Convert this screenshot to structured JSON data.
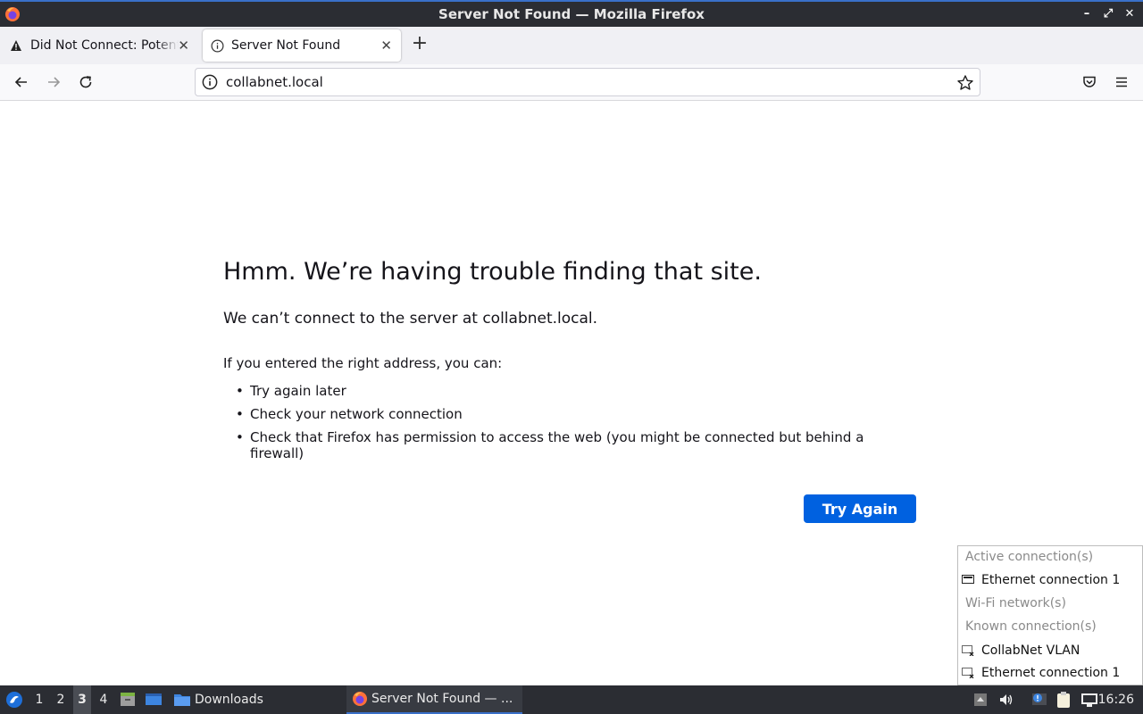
{
  "window": {
    "title": "Server Not Found — Mozilla Firefox"
  },
  "tabs": [
    {
      "title": "Did Not Connect: Potential Security Issue",
      "icon": "warning-icon",
      "active": false
    },
    {
      "title": "Server Not Found",
      "icon": "info-icon",
      "active": true
    }
  ],
  "navbar": {
    "url": "collabnet.local"
  },
  "error_page": {
    "title": "Hmm. We’re having trouble finding that site.",
    "description": "We can’t connect to the server at collabnet.local.",
    "hint": "If you entered the right address, you can:",
    "suggestions": [
      "Try again later",
      "Check your network connection",
      "Check that Firefox has permission to access the web (you might be connected but behind a firewall)"
    ],
    "try_again_label": "Try Again"
  },
  "network_menu": {
    "active_header": "Active connection(s)",
    "active_connections": [
      "Ethernet connection 1"
    ],
    "wifi_header": "Wi-Fi network(s)",
    "known_header": "Known connection(s)",
    "known_connections": [
      "CollabNet VLAN",
      "Ethernet connection 1"
    ]
  },
  "taskbar": {
    "workspaces": [
      "1",
      "2",
      "3",
      "4"
    ],
    "active_workspace": "3",
    "downloads_label": "Downloads",
    "window_title": "Server Not Found — ...",
    "clock": "16:26"
  },
  "colors": {
    "accent": "#0061e0",
    "titlebar": "#2b2d33",
    "highlight": "#3a70c9"
  }
}
